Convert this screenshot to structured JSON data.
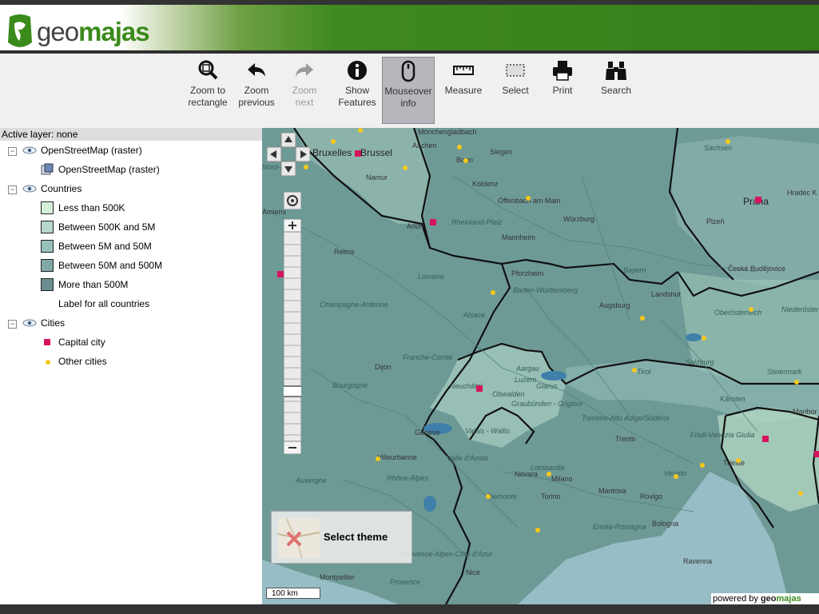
{
  "header": {
    "logo_prefix": "geo",
    "logo_suffix": "majas"
  },
  "toolbar": {
    "tools": [
      {
        "label": "Zoom to\nrectangle",
        "icon": "zoom-rectangle-icon",
        "state": "enabled"
      },
      {
        "label": "Zoom\nprevious",
        "icon": "undo-arrow-icon",
        "state": "enabled"
      },
      {
        "label": "Zoom\nnext",
        "icon": "redo-arrow-icon",
        "state": "disabled"
      },
      {
        "label": "Show\nFeatures",
        "icon": "info-icon",
        "state": "enabled"
      },
      {
        "label": "Mouseover\ninfo",
        "icon": "mouse-icon",
        "state": "active"
      },
      {
        "label": "Measure",
        "icon": "ruler-icon",
        "state": "enabled"
      },
      {
        "label": "Select",
        "icon": "select-rectangle-icon",
        "state": "enabled"
      },
      {
        "label": "Print",
        "icon": "printer-icon",
        "state": "enabled"
      },
      {
        "label": "Search",
        "icon": "binoculars-icon",
        "state": "enabled"
      }
    ]
  },
  "legend": {
    "active_layer": "Active layer: none",
    "layers": [
      {
        "name": "OpenStreetMap (raster)",
        "items": [
          {
            "label": "OpenStreetMap (raster)",
            "symbol": "raster-icon"
          }
        ]
      },
      {
        "name": "Countries",
        "items": [
          {
            "label": "Less than 500K",
            "color": "#d4efd9"
          },
          {
            "label": "Between 500K and 5M",
            "color": "#b8d8cc"
          },
          {
            "label": "Between 5M and 50M",
            "color": "#98c1bc"
          },
          {
            "label": "Between 50M and 500M",
            "color": "#7fa8a6"
          },
          {
            "label": "More than 500M",
            "color": "#6b8f90"
          },
          {
            "label": "Label for all countries",
            "color": null
          }
        ]
      },
      {
        "name": "Cities",
        "items": [
          {
            "label": "Capital city",
            "symbol": "capital-square",
            "color": "#d6145e"
          },
          {
            "label": "Other cities",
            "symbol": "city-dot",
            "color": "#f7c81c"
          }
        ]
      }
    ]
  },
  "map": {
    "region_labels": [
      "Bruxelles - Brussel",
      "Namur",
      "Nord-Pas",
      "Amiens",
      "Reims",
      "Lorraine",
      "Champagne-Ardenne",
      "Alsace",
      "Franche-Comté",
      "Bourgogne",
      "Dijon",
      "Genève",
      "Villeurbanne",
      "Auvergne",
      "Rhône-Alpes",
      "Montpellier",
      "Provence",
      "Provence-Alpes-Côte d'Azur",
      "Nice",
      "Koblenz",
      "Siegen",
      "Bonn",
      "Offenbach am Main",
      "Rheinland-Pfalz",
      "Würzburg",
      "Mannheim",
      "Pforzheim",
      "Baden-Württemberg",
      "Bayern",
      "Augsburg",
      "Landshut",
      "Sachsen",
      "Praha",
      "Plzeň",
      "Hradec K",
      "České Budějovice",
      "Oberösterreich",
      "Niederöster",
      "Salzburg",
      "Steiermark",
      "Kärnten",
      "Aargau",
      "Luzern",
      "Glarus",
      "Obwalden",
      "Graubünden - Grigioni",
      "Valais - Wallis",
      "Neuchâtel",
      "Trentino-Alto Adige/Südtirol",
      "Trento",
      "Friuli-Venezia Giulia",
      "Veneto",
      "Lombardia",
      "Milano",
      "Novara",
      "Piemonte",
      "Valle d'Aosta",
      "Torino",
      "Mantova",
      "Rovigo",
      "Emilia-Romagna",
      "Bologna",
      "Ravenna",
      "Trieste",
      "Maribor",
      "Tirol",
      "Aachen",
      "Mönchengladbach",
      "Arlon"
    ],
    "select_theme": "Select theme",
    "scale_label": "100 km",
    "powered_by_text": "powered by",
    "powered_by_brand_prefix": "geo",
    "powered_by_brand_suffix": "majas"
  }
}
